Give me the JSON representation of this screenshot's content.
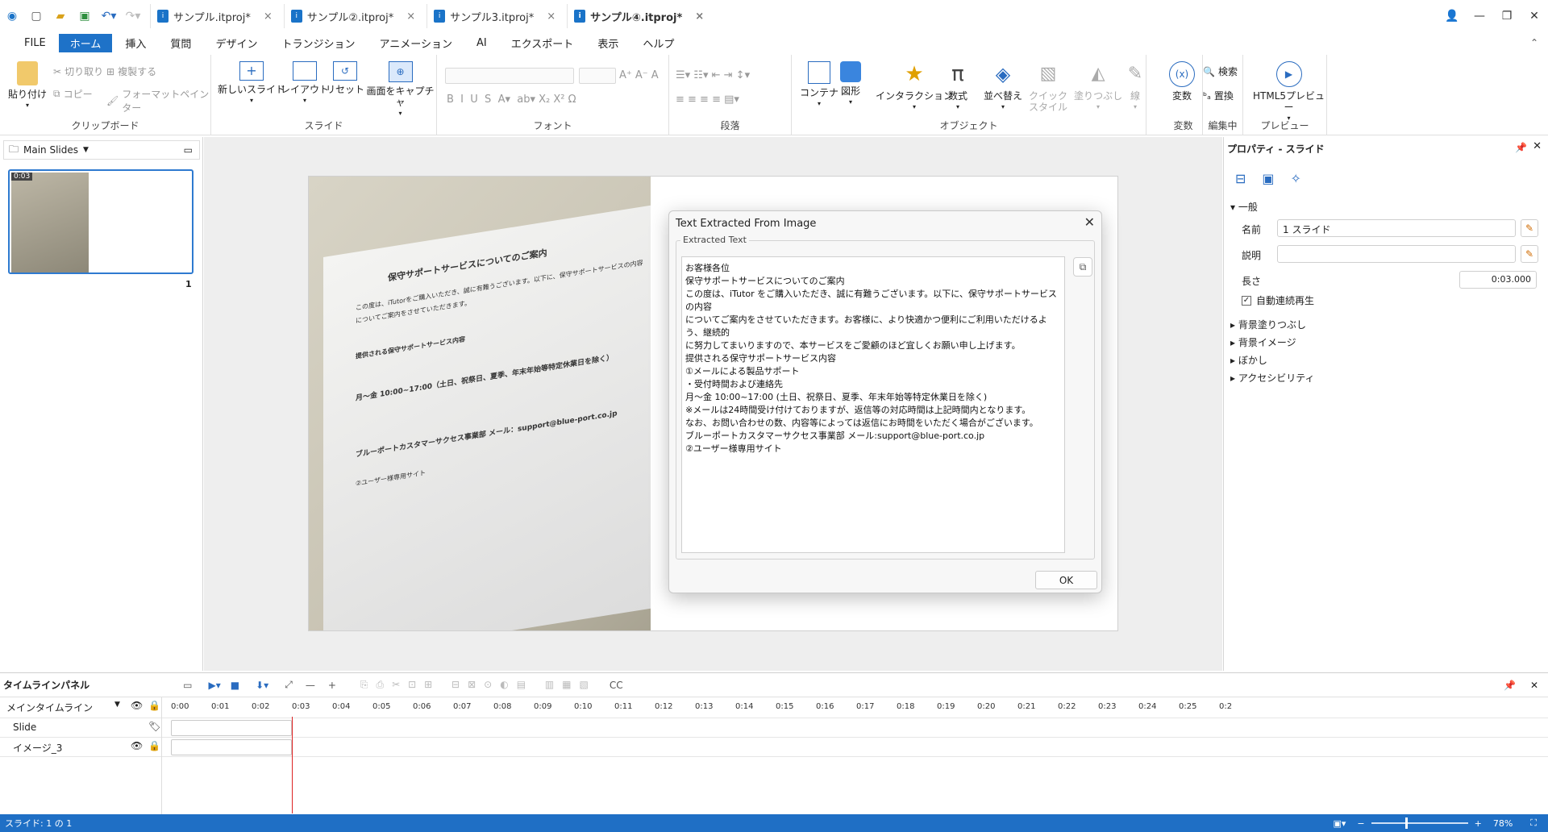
{
  "tabs": [
    {
      "label": "サンプル.itproj*",
      "active": false
    },
    {
      "label": "サンプル②.itproj*",
      "active": false
    },
    {
      "label": "サンプル3.itproj*",
      "active": false
    },
    {
      "label": "サンプル④.itproj*",
      "active": true
    }
  ],
  "menu": [
    "FILE",
    "ホーム",
    "挿入",
    "質問",
    "デザイン",
    "トランジション",
    "アニメーション",
    "AI",
    "エクスポート",
    "表示",
    "ヘルプ"
  ],
  "ribbon": {
    "clipboard": {
      "paste": "貼り付け",
      "cut": "切り取り",
      "copy": "コピー",
      "duplicate": "複製する",
      "format_painter": "フォーマットペインター",
      "label": "クリップボード"
    },
    "slide": {
      "new_slide": "新しいスライド",
      "layout": "レイアウト",
      "reset": "リセット",
      "capture": "画面をキャプチャ",
      "label": "スライド"
    },
    "font": {
      "label": "フォント"
    },
    "paragraph": {
      "label": "段落"
    },
    "object": {
      "content": "コンテナ",
      "shape": "図形",
      "interaction": "インタラクション",
      "equation": "数式",
      "arrange": "並べ替え",
      "quick_style_1": "クイック",
      "quick_style_2": "スタイル",
      "fill": "塗りつぶし",
      "line": "線",
      "label": "オブジェクト"
    },
    "variable": {
      "variable": "変数",
      "label": "変数"
    },
    "editing": {
      "search": "検索",
      "replace": "置換",
      "label": "編集中"
    },
    "preview": {
      "html5": "HTML5プレビュー",
      "label": "プレビュー"
    }
  },
  "slides_panel": {
    "title": "Main Slides",
    "thumb_time": "0:03",
    "thumb_number": "1"
  },
  "photo_text": {
    "heading": "保守サポートサービスについてのご案内",
    "line1": "この度は、iTutorをご購入いただき、誠に有難うございます。以下に、保守サポートサービスの内容",
    "line2": "についてご案内をさせていただきます。",
    "bullet": "提供される保守サポートサービス内容",
    "hours": "月～金 10:00~17:00（土日、祝祭日、夏季、年末年始等特定休業日を除く）",
    "email": "ブルーポートカスタマーサクセス事業部 メール：support@blue-port.co.jp",
    "site": "②ユーザー様専用サイト"
  },
  "dialog": {
    "title": "Text Extracted From Image",
    "group_label": "Extracted Text",
    "text": "お客様各位\n保守サポートサービスについてのご案内\nこの度は、iTutor をご購入いただき、誠に有難うございます。以下に、保守サポートサービスの内容\nについてご案内をさせていただきます。お客様に、より快適かつ便利にご利用いただけるよう、継続的\nに努力してまいりますので、本サービスをご愛顧のほど宜しくお願い申し上げます。\n提供される保守サポートサービス内容\n①メールによる製品サポート\n・受付時間および連絡先\n月～金 10:00~17:00 (土日、祝祭日、夏季、年末年始等特定休業日を除く)\n※メールは24時間受け付けておりますが、返信等の対応時間は上記時間内となります。\nなお、お問い合わせの数、内容等によっては返信にお時間をいただく場合がございます。\nブルーポートカスタマーサクセス事業部 メール:support@blue-port.co.jp\n②ユーザー様専用サイト",
    "ok": "OK"
  },
  "properties": {
    "title": "プロパティ - スライド",
    "general": "一般",
    "name_label": "名前",
    "name_value": "1 スライド",
    "desc_label": "説明",
    "desc_value": "",
    "length_label": "長さ",
    "length_value": "0:03.000",
    "autoplay": "自動連続再生",
    "autoplay_checked": true,
    "sections": [
      "背景塗りつぶし",
      "背景イメージ",
      "ぼかし",
      "アクセシビリティ"
    ]
  },
  "timeline": {
    "title": "タイムラインパネル",
    "main": "メインタイムライン",
    "rows": [
      "Slide",
      "イメージ_3"
    ],
    "ticks": [
      "0:00",
      "0:01",
      "0:02",
      "0:03",
      "0:04",
      "0:05",
      "0:06",
      "0:07",
      "0:08",
      "0:09",
      "0:10",
      "0:11",
      "0:12",
      "0:13",
      "0:14",
      "0:15",
      "0:16",
      "0:17",
      "0:18",
      "0:19",
      "0:20",
      "0:21",
      "0:22",
      "0:23",
      "0:24",
      "0:25",
      "0:2"
    ]
  },
  "status": {
    "slide": "スライド: 1 の 1",
    "zoom": "78%"
  },
  "colors": {
    "accent": "#1e72c8",
    "status_bar": "#1f6fc5",
    "playhead": "#dd2222"
  }
}
